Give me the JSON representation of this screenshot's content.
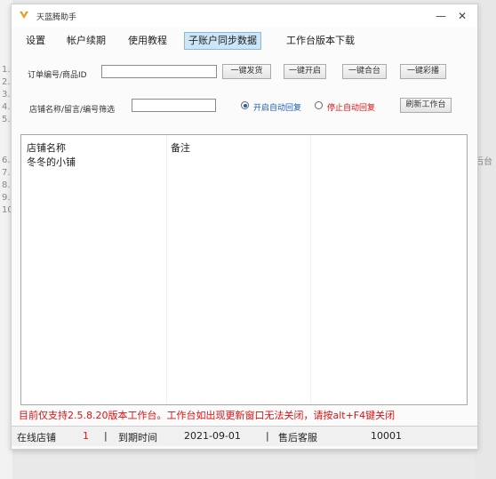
{
  "window": {
    "title": "天蓝腾助手"
  },
  "menu": {
    "items": [
      {
        "label": "设置"
      },
      {
        "label": "帐户续期"
      },
      {
        "label": "使用教程"
      },
      {
        "label": "子账户同步数据"
      },
      {
        "label": "工作台版本下载"
      }
    ]
  },
  "row1": {
    "label": "订单编号/商品ID",
    "input_value": "",
    "buttons": [
      {
        "label": "一键发货"
      },
      {
        "label": "一键开启"
      },
      {
        "label": "一键合台"
      },
      {
        "label": "一键彩播"
      }
    ]
  },
  "row2": {
    "label": "店铺名称/留言/编号筛选",
    "input_value": "",
    "radio_on_label": "开启自动回复",
    "radio_off_label": "停止自动回复",
    "refresh_button": "刷新工作台"
  },
  "list": {
    "columns": [
      "店铺名称",
      "备注"
    ],
    "rows": [
      {
        "shop": "冬冬的小铺",
        "note": ""
      }
    ]
  },
  "notice": "目前仅支持2.5.8.20版本工作台。工作台如出现更新窗口无法关闭，请按alt+F4键关闭",
  "status": {
    "online_label": "在线店铺",
    "online_value": "1",
    "expire_label": "到期时间",
    "expire_value": "2021-09-01",
    "support_label": "售后客服",
    "support_value": "10001"
  },
  "background": {
    "left_line_numbers": [
      "1.",
      "2.",
      "3.",
      "4.",
      "5.",
      "6.",
      "7.",
      "8.",
      "9.",
      "10"
    ],
    "right_fragment": "后台"
  },
  "colors": {
    "notice": "#dd1111",
    "active_tab": "#cde6f7",
    "radio_on": "#1a5fb4",
    "radio_off": "#dd1111"
  }
}
